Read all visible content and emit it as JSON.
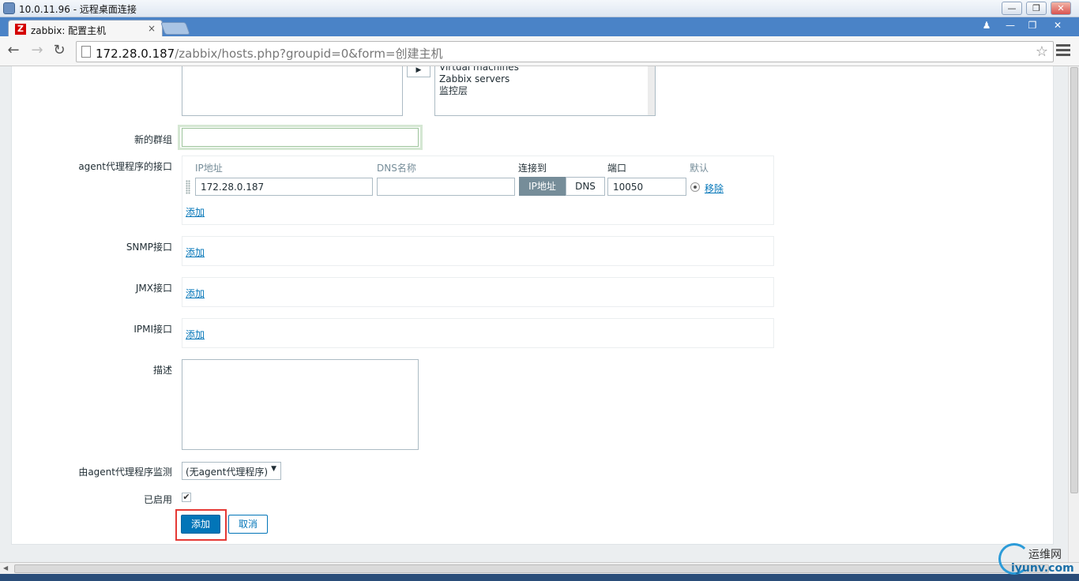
{
  "rdp": {
    "title": "10.0.11.96 - 远程桌面连接"
  },
  "browser": {
    "tab_title": "zabbix: 配置主机",
    "tab_close": "×",
    "url_host": "172.28.0.187",
    "url_path": "/zabbix/hosts.php?groupid=0&form=创建主机"
  },
  "form": {
    "other_groups": [
      "Virtual machines",
      "Zabbix servers",
      "监控层"
    ],
    "new_group_label": "新的群组",
    "new_group_value": "",
    "agent_interfaces_label": "agent代理程序的接口",
    "columns": {
      "ip": "IP地址",
      "dns": "DNS名称",
      "connect": "连接到",
      "port": "端口",
      "default": "默认"
    },
    "agent_interface": {
      "ip": "172.28.0.187",
      "dns": "",
      "connect_ip": "IP地址",
      "connect_dns": "DNS",
      "port": "10050",
      "remove": "移除"
    },
    "add_link": "添加",
    "snmp_label": "SNMP接口",
    "jmx_label": "JMX接口",
    "ipmi_label": "IPMI接口",
    "description_label": "描述",
    "description_value": "",
    "proxy_label": "由agent代理程序监测",
    "proxy_value": "(无agent代理程序)",
    "enabled_label": "已启用",
    "enabled": true,
    "add_button": "添加",
    "cancel_button": "取消"
  },
  "watermark": {
    "name": "运维网",
    "site": "iyunv.com"
  }
}
